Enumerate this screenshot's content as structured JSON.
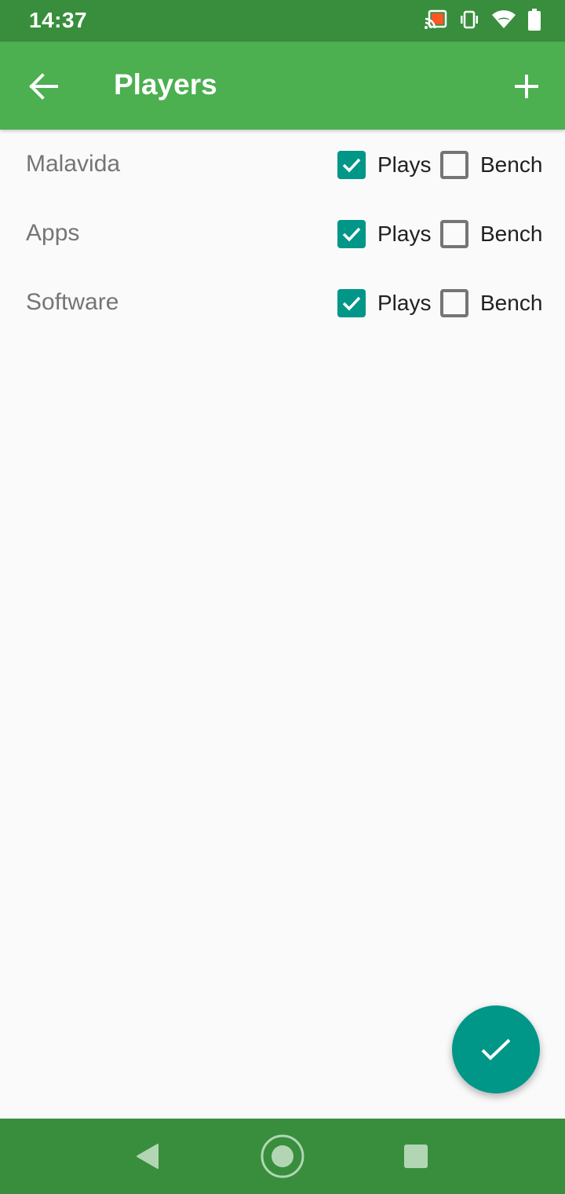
{
  "status_bar": {
    "time": "14:37",
    "icons": [
      "cast-icon",
      "vibrate-icon",
      "wifi-icon",
      "battery-icon"
    ],
    "cast_accent": "#ff5722"
  },
  "app_bar": {
    "title": "Players",
    "back_icon": "arrow-left-icon",
    "add_icon": "plus-icon",
    "color": "#4caf50"
  },
  "players": [
    {
      "name": "Malavida",
      "plays_label": "Plays",
      "plays_checked": true,
      "bench_label": "Bench",
      "bench_checked": false
    },
    {
      "name": "Apps",
      "plays_label": "Plays",
      "plays_checked": true,
      "bench_label": "Bench",
      "bench_checked": false
    },
    {
      "name": "Software",
      "plays_label": "Plays",
      "plays_checked": true,
      "bench_label": "Bench",
      "bench_checked": false
    }
  ],
  "fab": {
    "icon": "check-icon",
    "color": "#009688"
  },
  "nav_bar": {
    "buttons": [
      "back-triangle-icon",
      "home-circle-icon",
      "recents-square-icon"
    ],
    "color": "#388e3c"
  }
}
